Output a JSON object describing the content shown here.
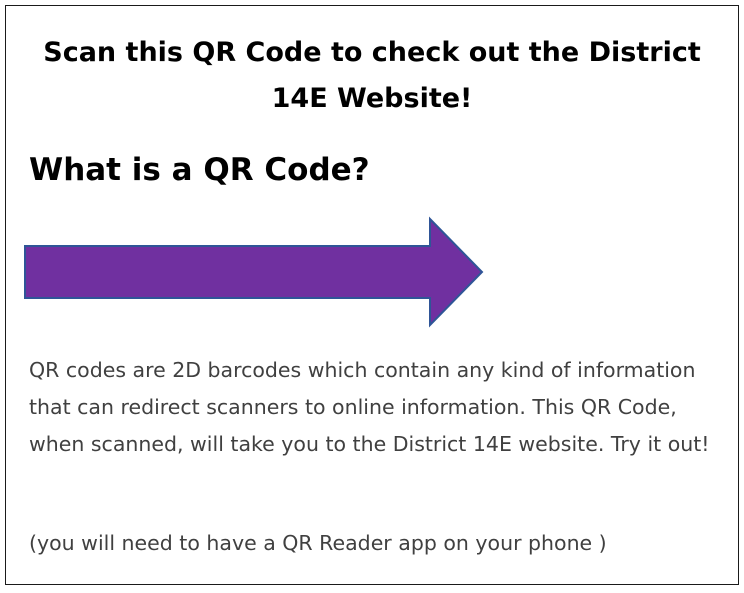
{
  "headline": "Scan this QR Code to check out the District 14E Website!",
  "subheading": "What is a QR Code?",
  "arrow": {
    "icon": "right-arrow-icon",
    "fill": "#7030a0",
    "stroke": "#2f5597"
  },
  "body_text": "QR codes are 2D barcodes which contain any kind of information that can redirect scanners to online information.  This QR Code, when scanned, will take you to the District 14E website.  Try it out!",
  "note": "(you will need to have a QR Reader app on your phone )"
}
